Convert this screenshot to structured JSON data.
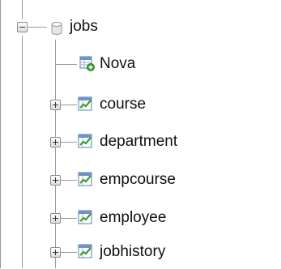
{
  "tree": {
    "root": {
      "label": "jobs",
      "expanded": true,
      "icon": "database-icon"
    },
    "children": [
      {
        "label": "Nova",
        "icon": "new-table-icon",
        "expandable": false
      },
      {
        "label": "course",
        "icon": "table-icon",
        "expandable": true
      },
      {
        "label": "department",
        "icon": "table-icon",
        "expandable": true
      },
      {
        "label": "empcourse",
        "icon": "table-icon",
        "expandable": true
      },
      {
        "label": "employee",
        "icon": "table-icon",
        "expandable": true
      },
      {
        "label": "jobhistory",
        "icon": "table-icon",
        "expandable": true
      }
    ]
  }
}
